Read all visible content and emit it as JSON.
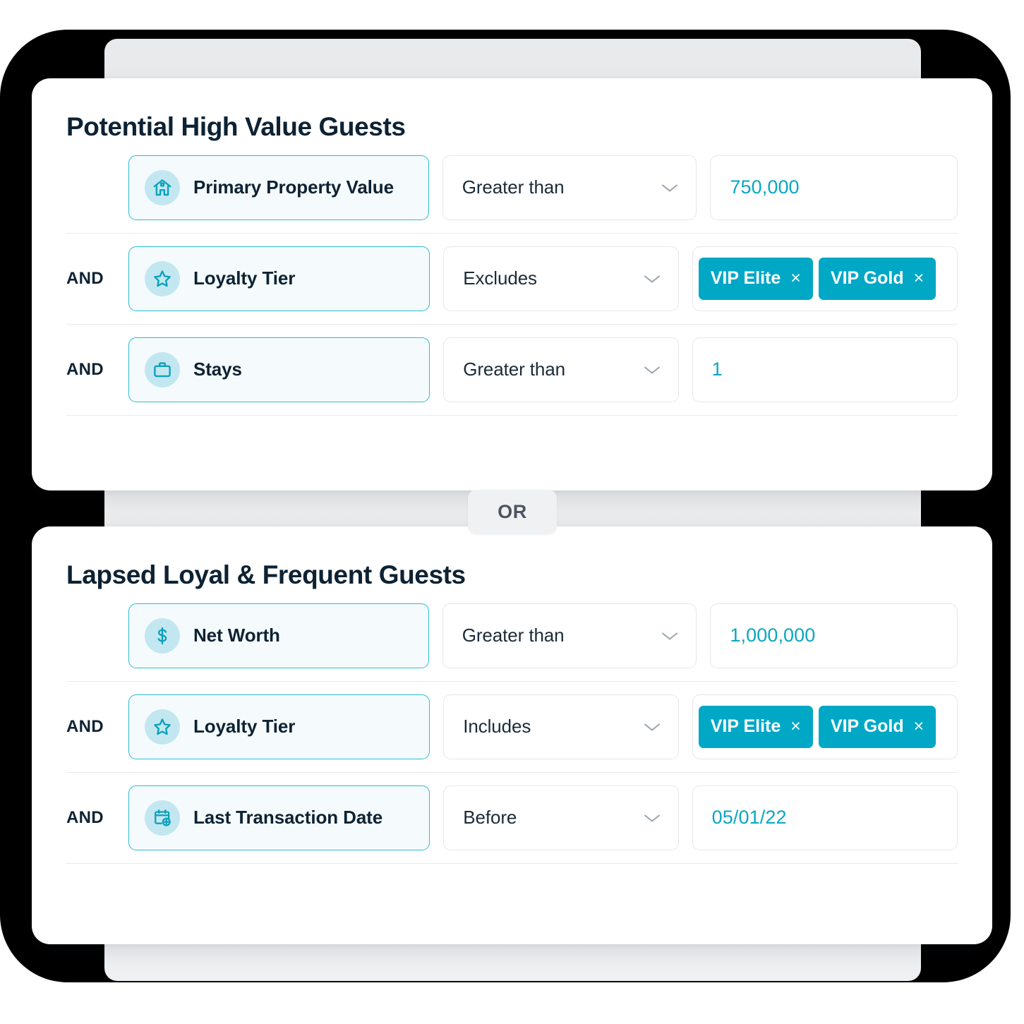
{
  "connector_badge": {
    "label": "OR"
  },
  "colors": {
    "accent_teal": "#00a8c6",
    "value_text": "#0aa7c2",
    "attr_border": "#2bbcd4",
    "attr_bg": "#f5fbfd",
    "icon_circle": "#c3e7f0",
    "title_text": "#0d2233",
    "panel_gray": "#ecedef",
    "backdrop": "#000000"
  },
  "cards": [
    {
      "title": "Potential High Value Guests",
      "rules": [
        {
          "connector": "",
          "attribute": "Primary Property Value",
          "icon": "house-icon",
          "operator": "Greater than",
          "value_type": "text",
          "value": "750,000"
        },
        {
          "connector": "AND",
          "attribute": "Loyalty Tier",
          "icon": "star-icon",
          "operator": "Excludes",
          "value_type": "tags",
          "tags": [
            "VIP Elite",
            "VIP Gold"
          ]
        },
        {
          "connector": "AND",
          "attribute": "Stays",
          "icon": "briefcase-icon",
          "operator": "Greater than",
          "value_type": "text",
          "value": "1"
        }
      ]
    },
    {
      "title": "Lapsed Loyal & Frequent Guests",
      "rules": [
        {
          "connector": "",
          "attribute": "Net Worth",
          "icon": "dollar-icon",
          "operator": "Greater than",
          "value_type": "text",
          "value": "1,000,000"
        },
        {
          "connector": "AND",
          "attribute": "Loyalty Tier",
          "icon": "star-icon",
          "operator": "Includes",
          "value_type": "tags",
          "tags": [
            "VIP Elite",
            "VIP Gold"
          ]
        },
        {
          "connector": "AND",
          "attribute": "Last Transaction Date",
          "icon": "calendar-plus-icon",
          "operator": "Before",
          "value_type": "text",
          "value": "05/01/22"
        }
      ]
    }
  ],
  "tag_remove_glyph": "×"
}
